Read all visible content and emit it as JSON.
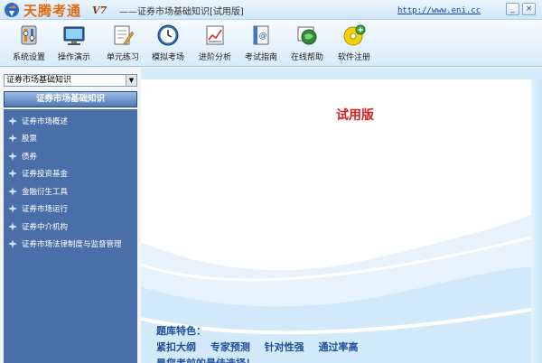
{
  "titlebar": {
    "app_name": "天腾考通",
    "version": "V7",
    "window_title": "——证券市场基础知识[试用版]",
    "site_url": "http://www.eni.cc",
    "controls": [
      "_",
      "×"
    ]
  },
  "toolbar": {
    "items": [
      {
        "label": "系统设置",
        "icon": "settings-icon"
      },
      {
        "label": "操作演示",
        "icon": "monitor-icon"
      },
      {
        "label": "单元练习",
        "icon": "document-edit-icon"
      },
      {
        "label": "模拟考场",
        "icon": "clock-icon"
      },
      {
        "label": "进阶分析",
        "icon": "chart-icon"
      },
      {
        "label": "考试指南",
        "icon": "guide-book-icon"
      },
      {
        "label": "在线帮助",
        "icon": "globe-help-icon"
      },
      {
        "label": "软件注册",
        "icon": "register-disc-icon"
      }
    ]
  },
  "sidebar": {
    "subject_select": "证券市场基础知识",
    "header": "证券市场基础知识",
    "items": [
      {
        "label": "证券市场概述"
      },
      {
        "label": "股票"
      },
      {
        "label": "债券"
      },
      {
        "label": "证券投资基金"
      },
      {
        "label": "金融衍生工具"
      },
      {
        "label": "证券市场运行"
      },
      {
        "label": "证券中介机构"
      },
      {
        "label": "证券市场法律制度与监督管理"
      }
    ]
  },
  "main": {
    "trial_label": "试用版",
    "features_title": "题库特色：",
    "features": [
      "紧扣大纲",
      "专家预测",
      "针对性强",
      "通过率高"
    ],
    "closing": "是您考前的最佳选择！"
  },
  "colors": {
    "sidebar_bg": "#4a6fa8",
    "trial_red": "#d62020",
    "feature_blue": "#1f4f9a",
    "brand_orange": "#e06a10"
  }
}
